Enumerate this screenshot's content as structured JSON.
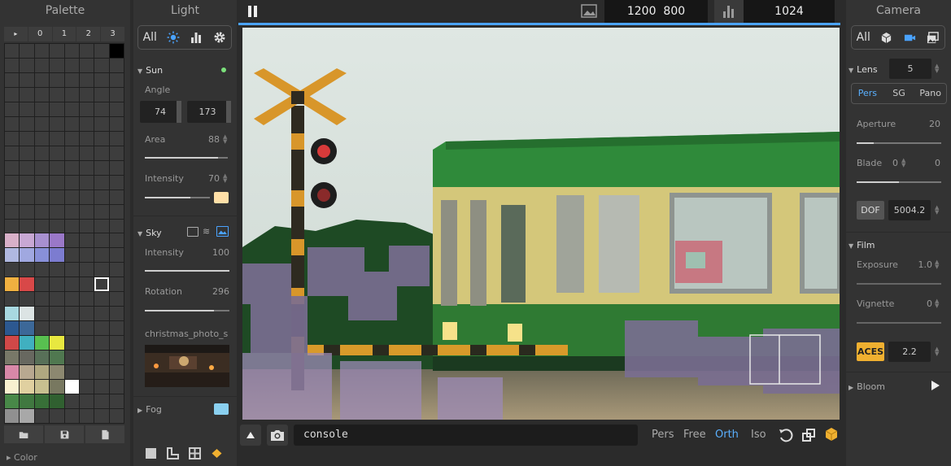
{
  "palette": {
    "title": "Palette",
    "tabs": [
      "▸",
      "0",
      "1",
      "2",
      "3"
    ],
    "footer_label": "Color",
    "tools": [
      "folder-open-icon",
      "save-icon",
      "file-icon"
    ],
    "swatch_colors": {
      "r14": [
        "#d8b0c8",
        "#c8a8d4",
        "#a890d0",
        "#9a78c8"
      ],
      "r15": [
        "#b0b8e0",
        "#a0a8e0",
        "#8890d8",
        "#7c7cd0"
      ],
      "r17": [
        "#f0b040",
        "#d84848"
      ],
      "r19": [
        "#a8d8e0",
        "#dce4e4"
      ],
      "r20": [
        "#2c5890",
        "#3c6898"
      ],
      "r21": [
        "#d04848",
        "#40b0c0",
        "#58c050",
        "#e8e840"
      ],
      "r22": [
        "#787868",
        "#686860",
        "#587058",
        "#507850"
      ],
      "r23": [
        "#d888a8",
        "#b8a890",
        "#b0a880",
        "#8c8870"
      ],
      "r24": [
        "#f8f0d0",
        "#e0d0a0",
        "#c8c090",
        "#787860",
        "#ffffff"
      ],
      "r25": [
        "#488848",
        "#407840",
        "#387038",
        "#306030"
      ],
      "r26": [
        "#909090",
        "#a8a8a8"
      ],
      "r27": [
        "#f8e0c8",
        "#3c3c3c",
        "#f0c090",
        "#e8b880",
        "#e0b070",
        "#d8a060",
        "#d89838",
        "#c89030"
      ]
    }
  },
  "light": {
    "title": "Light",
    "tabs": {
      "all": "All"
    },
    "sun": {
      "label": "Sun",
      "angle_label": "Angle",
      "angle_a": "74",
      "angle_b": "173",
      "area_label": "Area",
      "area": "88",
      "intensity_label": "Intensity",
      "intensity": "70",
      "color": "#ffe0a8",
      "area_fraction": 0.88,
      "intensity_fraction": 0.7
    },
    "sky": {
      "label": "Sky",
      "intensity_label": "Intensity",
      "intensity": "100",
      "rotation_label": "Rotation",
      "rotation": "296",
      "env_name": "christmas_photo_s",
      "intensity_fraction": 1.0,
      "rotation_fraction": 0.82
    },
    "fog": {
      "label": "Fog",
      "color": "#8ad0f0"
    }
  },
  "topbar": {
    "width": "1200",
    "height": "800",
    "samples": "1024"
  },
  "bottombar": {
    "console_placeholder": "console",
    "projections": [
      "Pers",
      "Free",
      "Orth",
      "Iso"
    ],
    "active_projection": "Orth"
  },
  "camera": {
    "title": "Camera",
    "tabs": {
      "all": "All"
    },
    "lens": {
      "label": "Lens",
      "value": "5"
    },
    "projections": [
      "Pers",
      "SG",
      "Pano"
    ],
    "active_projection": "Pers",
    "aperture": {
      "label": "Aperture",
      "value": "20",
      "fraction": 0.2
    },
    "blade": {
      "label": "Blade",
      "value_a": "0",
      "value_b": "0",
      "fraction": 0.5
    },
    "dof": {
      "label": "DOF",
      "value": "5004.2"
    },
    "film": {
      "label": "Film"
    },
    "exposure": {
      "label": "Exposure",
      "value": "1.0"
    },
    "vignette": {
      "label": "Vignette",
      "value": "0"
    },
    "aces": {
      "label": "ACES",
      "value": "2.2"
    },
    "bloom": {
      "label": "Bloom"
    }
  }
}
